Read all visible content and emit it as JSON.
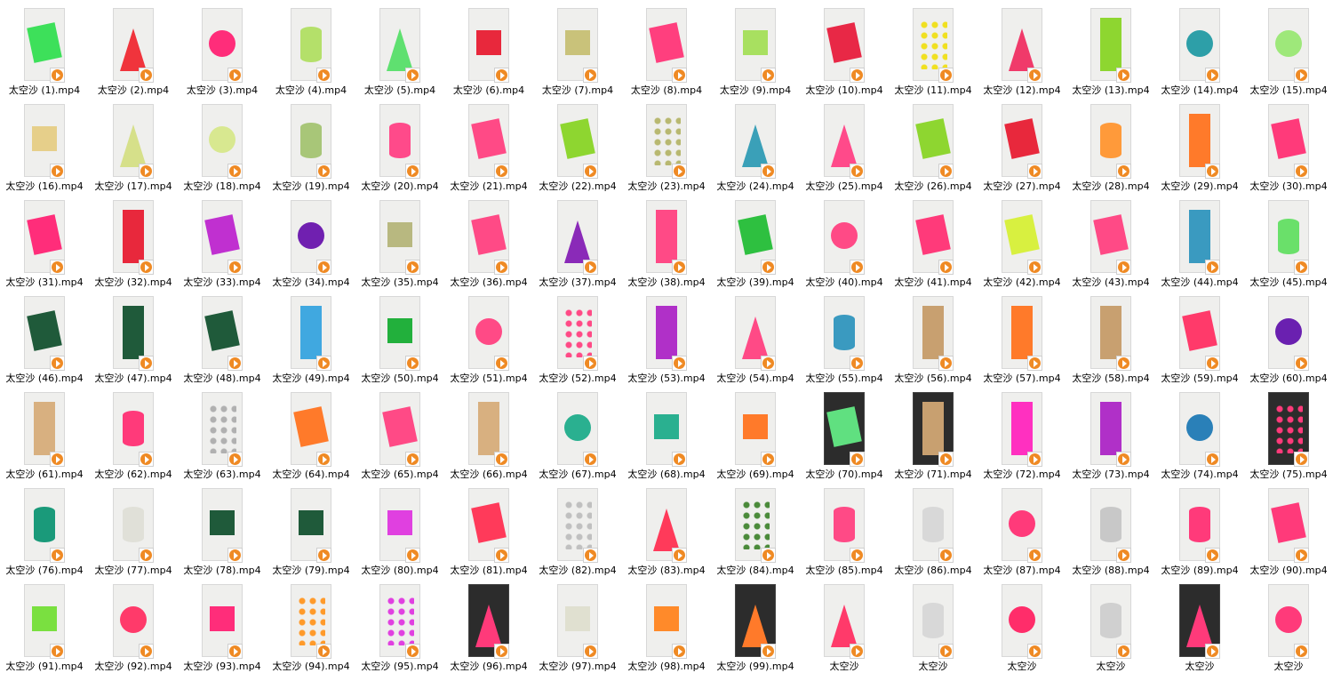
{
  "explorer": {
    "view": "large-icons",
    "files": [
      {
        "name": "太空沙 (1).mp4",
        "shape": "rect",
        "color": "#3de05a"
      },
      {
        "name": "太空沙 (2).mp4",
        "shape": "cone",
        "color": "#f0343c"
      },
      {
        "name": "太空沙 (3).mp4",
        "shape": "ball",
        "color": "#ff2d7a"
      },
      {
        "name": "太空沙 (4).mp4",
        "shape": "cyl",
        "color": "#b4e06a"
      },
      {
        "name": "太空沙 (5).mp4",
        "shape": "cone",
        "color": "#5fe070"
      },
      {
        "name": "太空沙 (6).mp4",
        "shape": "cube",
        "color": "#e8283c"
      },
      {
        "name": "太空沙 (7).mp4",
        "shape": "cube",
        "color": "#c9c27a"
      },
      {
        "name": "太空沙 (8).mp4",
        "shape": "rect",
        "color": "#ff3f7e"
      },
      {
        "name": "太空沙 (9).mp4",
        "shape": "cube",
        "color": "#a8e060"
      },
      {
        "name": "太空沙 (10).mp4",
        "shape": "rect",
        "color": "#e82846"
      },
      {
        "name": "太空沙 (11).mp4",
        "shape": "dots",
        "color": "#f0e020"
      },
      {
        "name": "太空沙 (12).mp4",
        "shape": "cone",
        "color": "#f03a6a"
      },
      {
        "name": "太空沙 (13).mp4",
        "shape": "tall",
        "color": "#8ed630"
      },
      {
        "name": "太空沙 (14).mp4",
        "shape": "ball",
        "color": "#2d9fa8"
      },
      {
        "name": "太空沙 (15).mp4",
        "shape": "ball",
        "color": "#9ee87a"
      },
      {
        "name": "太空沙 (16).mp4",
        "shape": "cube",
        "color": "#e6cf8a"
      },
      {
        "name": "太空沙 (17).mp4",
        "shape": "cone",
        "color": "#d6e08a"
      },
      {
        "name": "太空沙 (18).mp4",
        "shape": "ball",
        "color": "#d8e890"
      },
      {
        "name": "太空沙 (19).mp4",
        "shape": "cyl",
        "color": "#a8c678"
      },
      {
        "name": "太空沙 (20).mp4",
        "shape": "cyl",
        "color": "#ff4a8a"
      },
      {
        "name": "太空沙 (21).mp4",
        "shape": "rect",
        "color": "#ff4a86"
      },
      {
        "name": "太空沙 (22).mp4",
        "shape": "rect",
        "color": "#8ed630"
      },
      {
        "name": "太空沙 (23).mp4",
        "shape": "dots",
        "color": "#b8b870"
      },
      {
        "name": "太空沙 (24).mp4",
        "shape": "cone",
        "color": "#3aa0b8"
      },
      {
        "name": "太空沙 (25).mp4",
        "shape": "cone",
        "color": "#ff4a8a"
      },
      {
        "name": "太空沙 (26).mp4",
        "shape": "rect",
        "color": "#8ed630"
      },
      {
        "name": "太空沙 (27).mp4",
        "shape": "rect",
        "color": "#e8283c"
      },
      {
        "name": "太空沙 (28).mp4",
        "shape": "cyl",
        "color": "#ff9a3a"
      },
      {
        "name": "太空沙 (29).mp4",
        "shape": "tall",
        "color": "#ff7a2a"
      },
      {
        "name": "太空沙 (30).mp4",
        "shape": "rect",
        "color": "#ff3a7a"
      },
      {
        "name": "太空沙 (31).mp4",
        "shape": "rect",
        "color": "#ff2d7a"
      },
      {
        "name": "太空沙 (32).mp4",
        "shape": "tall",
        "color": "#e8283c"
      },
      {
        "name": "太空沙 (33).mp4",
        "shape": "rect",
        "color": "#c030d0"
      },
      {
        "name": "太空沙 (34).mp4",
        "shape": "ball",
        "color": "#7020b0"
      },
      {
        "name": "太空沙 (35).mp4",
        "shape": "cube",
        "color": "#b8b880"
      },
      {
        "name": "太空沙 (36).mp4",
        "shape": "rect",
        "color": "#ff4a86"
      },
      {
        "name": "太空沙 (37).mp4",
        "shape": "cone",
        "color": "#8a2ab8"
      },
      {
        "name": "太空沙 (38).mp4",
        "shape": "tall",
        "color": "#ff4a86"
      },
      {
        "name": "太空沙 (39).mp4",
        "shape": "rect",
        "color": "#2ec040"
      },
      {
        "name": "太空沙 (40).mp4",
        "shape": "ball",
        "color": "#ff4a86"
      },
      {
        "name": "太空沙 (41).mp4",
        "shape": "rect",
        "color": "#ff3a7a"
      },
      {
        "name": "太空沙 (42).mp4",
        "shape": "rect",
        "color": "#d8f040"
      },
      {
        "name": "太空沙 (43).mp4",
        "shape": "rect",
        "color": "#ff4a86"
      },
      {
        "name": "太空沙 (44).mp4",
        "shape": "tall",
        "color": "#3a9ac0"
      },
      {
        "name": "太空沙 (45).mp4",
        "shape": "cyl",
        "color": "#6ae06a"
      },
      {
        "name": "太空沙 (46).mp4",
        "shape": "rect",
        "color": "#1f5a3a"
      },
      {
        "name": "太空沙 (47).mp4",
        "shape": "tall",
        "color": "#1f5a3a"
      },
      {
        "name": "太空沙 (48).mp4",
        "shape": "rect",
        "color": "#1f5a3a"
      },
      {
        "name": "太空沙 (49).mp4",
        "shape": "tall",
        "color": "#40a8e0"
      },
      {
        "name": "太空沙 (50).mp4",
        "shape": "cube",
        "color": "#22b03c"
      },
      {
        "name": "太空沙 (51).mp4",
        "shape": "ball",
        "color": "#ff4a86"
      },
      {
        "name": "太空沙 (52).mp4",
        "shape": "dots",
        "color": "#ff4a86"
      },
      {
        "name": "太空沙 (53).mp4",
        "shape": "tall",
        "color": "#b030c8"
      },
      {
        "name": "太空沙 (54).mp4",
        "shape": "cone",
        "color": "#ff4a86"
      },
      {
        "name": "太空沙 (55).mp4",
        "shape": "cyl",
        "color": "#3a9ac0"
      },
      {
        "name": "太空沙 (56).mp4",
        "shape": "tall",
        "color": "#c8a070"
      },
      {
        "name": "太空沙 (57).mp4",
        "shape": "tall",
        "color": "#ff7a2a"
      },
      {
        "name": "太空沙 (58).mp4",
        "shape": "tall",
        "color": "#c8a070"
      },
      {
        "name": "太空沙 (59).mp4",
        "shape": "rect",
        "color": "#ff3a6a"
      },
      {
        "name": "太空沙 (60).mp4",
        "shape": "ball",
        "color": "#6a20b0"
      },
      {
        "name": "太空沙 (61).mp4",
        "shape": "tall",
        "color": "#d8b080"
      },
      {
        "name": "太空沙 (62).mp4",
        "shape": "cyl",
        "color": "#ff3a7a"
      },
      {
        "name": "太空沙 (63).mp4",
        "shape": "dots",
        "color": "#b0b0b0"
      },
      {
        "name": "太空沙 (64).mp4",
        "shape": "rect",
        "color": "#ff7a2a"
      },
      {
        "name": "太空沙 (65).mp4",
        "shape": "rect",
        "color": "#ff4a86"
      },
      {
        "name": "太空沙 (66).mp4",
        "shape": "tall",
        "color": "#d8b080"
      },
      {
        "name": "太空沙 (67).mp4",
        "shape": "ball",
        "color": "#2ab090"
      },
      {
        "name": "太空沙 (68).mp4",
        "shape": "cube",
        "color": "#2ab090"
      },
      {
        "name": "太空沙 (69).mp4",
        "shape": "cube",
        "color": "#ff7a2a"
      },
      {
        "name": "太空沙 (70).mp4",
        "shape": "rect",
        "color": "#60e080"
      },
      {
        "name": "太空沙 (71).mp4",
        "shape": "tall",
        "color": "#c8a070"
      },
      {
        "name": "太空沙 (72).mp4",
        "shape": "tall",
        "color": "#ff30c0"
      },
      {
        "name": "太空沙 (73).mp4",
        "shape": "tall",
        "color": "#b030c8"
      },
      {
        "name": "太空沙 (74).mp4",
        "shape": "ball",
        "color": "#2a80b8"
      },
      {
        "name": "太空沙 (75).mp4",
        "shape": "dots",
        "color": "#ff3a7a"
      },
      {
        "name": "太空沙 (76).mp4",
        "shape": "cyl",
        "color": "#1a9a7a"
      },
      {
        "name": "太空沙 (77).mp4",
        "shape": "cyl",
        "color": "#e0e0d8"
      },
      {
        "name": "太空沙 (78).mp4",
        "shape": "cube",
        "color": "#1f5a3a"
      },
      {
        "name": "太空沙 (79).mp4",
        "shape": "cube",
        "color": "#1f5a3a"
      },
      {
        "name": "太空沙 (80).mp4",
        "shape": "cube",
        "color": "#e040e0"
      },
      {
        "name": "太空沙 (81).mp4",
        "shape": "rect",
        "color": "#ff3a5a"
      },
      {
        "name": "太空沙 (82).mp4",
        "shape": "dots",
        "color": "#c0c0c0"
      },
      {
        "name": "太空沙 (83).mp4",
        "shape": "cone",
        "color": "#ff3a5a"
      },
      {
        "name": "太空沙 (84).mp4",
        "shape": "dots",
        "color": "#4a8a3a"
      },
      {
        "name": "太空沙 (85).mp4",
        "shape": "cyl",
        "color": "#ff4a86"
      },
      {
        "name": "太空沙 (86).mp4",
        "shape": "cyl",
        "color": "#d8d8d8"
      },
      {
        "name": "太空沙 (87).mp4",
        "shape": "ball",
        "color": "#ff3a7a"
      },
      {
        "name": "太空沙 (88).mp4",
        "shape": "cyl",
        "color": "#c8c8c8"
      },
      {
        "name": "太空沙 (89).mp4",
        "shape": "cyl",
        "color": "#ff3a7a"
      },
      {
        "name": "太空沙 (90).mp4",
        "shape": "rect",
        "color": "#ff3a7a"
      },
      {
        "name": "太空沙 (91).mp4",
        "shape": "cube",
        "color": "#7ae040"
      },
      {
        "name": "太空沙 (92).mp4",
        "shape": "ball",
        "color": "#ff3a6a"
      },
      {
        "name": "太空沙 (93).mp4",
        "shape": "cube",
        "color": "#ff2d7a"
      },
      {
        "name": "太空沙 (94).mp4",
        "shape": "dots",
        "color": "#ff9a2a"
      },
      {
        "name": "太空沙 (95).mp4",
        "shape": "dots",
        "color": "#e040e0"
      },
      {
        "name": "太空沙 (96).mp4",
        "shape": "cone",
        "color": "#ff3a7a"
      },
      {
        "name": "太空沙 (97).mp4",
        "shape": "cube",
        "color": "#e0e0d0"
      },
      {
        "name": "太空沙 (98).mp4",
        "shape": "cube",
        "color": "#ff8a2a"
      },
      {
        "name": "太空沙 (99).mp4",
        "shape": "cone",
        "color": "#ff7a2a"
      },
      {
        "name": "太空沙",
        "shape": "cone",
        "color": "#ff3a6a"
      },
      {
        "name": "太空沙",
        "shape": "cyl",
        "color": "#d8d8d8"
      },
      {
        "name": "太空沙",
        "shape": "ball",
        "color": "#ff2d6a"
      },
      {
        "name": "太空沙",
        "shape": "cyl",
        "color": "#d0d0d0"
      },
      {
        "name": "太空沙",
        "shape": "cone",
        "color": "#ff3a7a"
      },
      {
        "name": "太空沙",
        "shape": "ball",
        "color": "#ff3a7a"
      }
    ]
  }
}
